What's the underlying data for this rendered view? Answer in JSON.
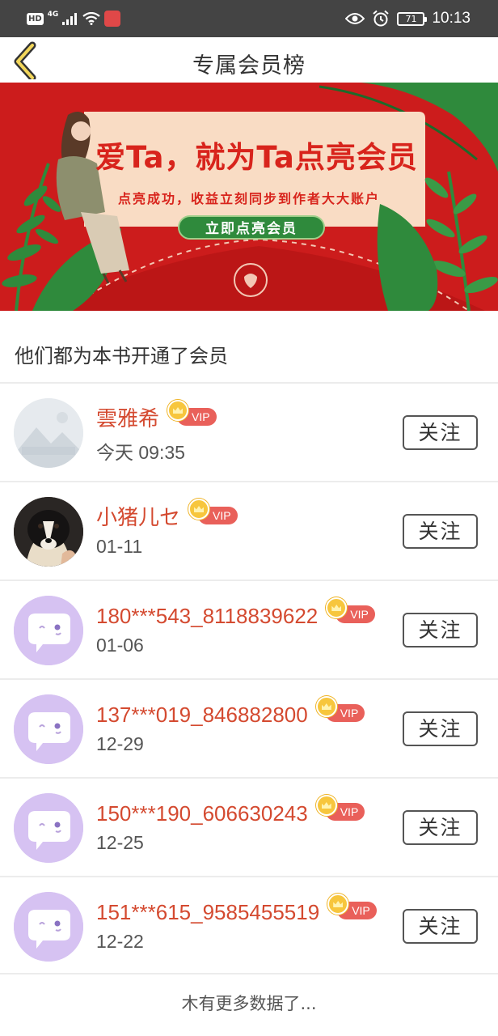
{
  "status_bar": {
    "hd": "HD",
    "network": "4G",
    "battery": "71",
    "time": "10:13"
  },
  "header": {
    "title": "专属会员榜"
  },
  "banner": {
    "title": "爱Ta，就为Ta点亮会员",
    "subtitle": "点亮成功，收益立刻同步到作者大大账户",
    "cta_label": "立即点亮会员"
  },
  "section": {
    "title": "他们都为本书开通了会员"
  },
  "members": [
    {
      "name": "雲雅希",
      "vip": "VIP",
      "time": "今天 09:35",
      "follow": "关注",
      "avatar": "landscape-placeholder"
    },
    {
      "name": "小猪儿セ",
      "vip": "VIP",
      "time": "01-11",
      "follow": "关注",
      "avatar": "dog-photo"
    },
    {
      "name": "180***543_8118839622",
      "vip": "VIP",
      "time": "01-06",
      "follow": "关注",
      "avatar": "chat-bubble-face"
    },
    {
      "name": "137***019_846882800",
      "vip": "VIP",
      "time": "12-29",
      "follow": "关注",
      "avatar": "chat-bubble-face"
    },
    {
      "name": "150***190_606630243",
      "vip": "VIP",
      "time": "12-25",
      "follow": "关注",
      "avatar": "chat-bubble-face"
    },
    {
      "name": "151***615_9585455519",
      "vip": "VIP",
      "time": "12-22",
      "follow": "关注",
      "avatar": "chat-bubble-face"
    }
  ],
  "footer": {
    "text": "木有更多数据了..."
  },
  "colors": {
    "status_bar": "#444444",
    "banner_red": "#cc1c1c",
    "name_red": "#d44a30",
    "vip_badge": "#e9605a",
    "avatar_purple": "#d6c2f2"
  }
}
